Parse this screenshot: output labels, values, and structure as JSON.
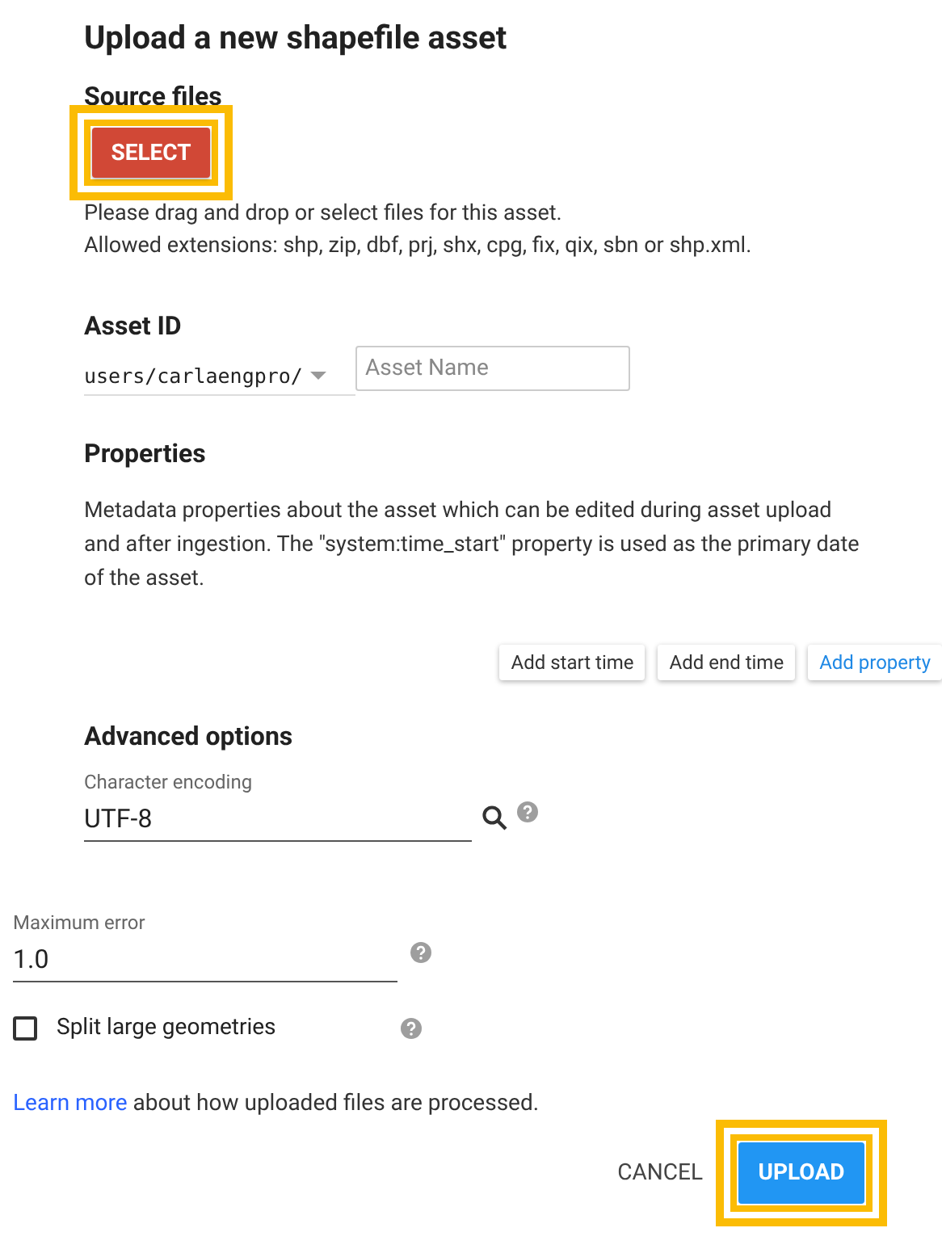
{
  "title": "Upload a new shapefile asset",
  "source_files": {
    "heading": "Source files",
    "button": {
      "label": "SELECT",
      "highlighted": true
    },
    "hint_lines": [
      "Please drag and drop or select files for this asset.",
      "Allowed extensions: shp, zip, dbf, prj, shx, cpg, fix, qix, sbn or shp.xml."
    ]
  },
  "asset_id": {
    "heading": "Asset ID",
    "prefix": "users/carlaengpro/",
    "name_placeholder": "Asset Name"
  },
  "properties": {
    "heading": "Properties",
    "description_lines": [
      "Metadata properties about the asset which can be edited during asset upload",
      "and after ingestion. The \"system:time_start\" property is used as the primary date",
      "of the asset."
    ],
    "buttons": [
      {
        "label": "Add start time",
        "kind": "plain"
      },
      {
        "label": "Add end time",
        "kind": "plain"
      },
      {
        "label": "Add property",
        "kind": "accent"
      }
    ]
  },
  "advanced": {
    "heading": "Advanced options",
    "encoding": {
      "label": "Character encoding",
      "value": "UTF-8"
    },
    "max_error": {
      "label": "Maximum error",
      "value": "1.0"
    },
    "split": {
      "label": "Split large geometries",
      "checked": false
    }
  },
  "learn_more": {
    "link": "Learn more",
    "text": " about how uploaded files are processed."
  },
  "actions": [
    {
      "label": "CANCEL",
      "kind": "flat",
      "highlighted": false
    },
    {
      "label": "UPLOAD",
      "kind": "primary",
      "highlighted": true
    }
  ]
}
